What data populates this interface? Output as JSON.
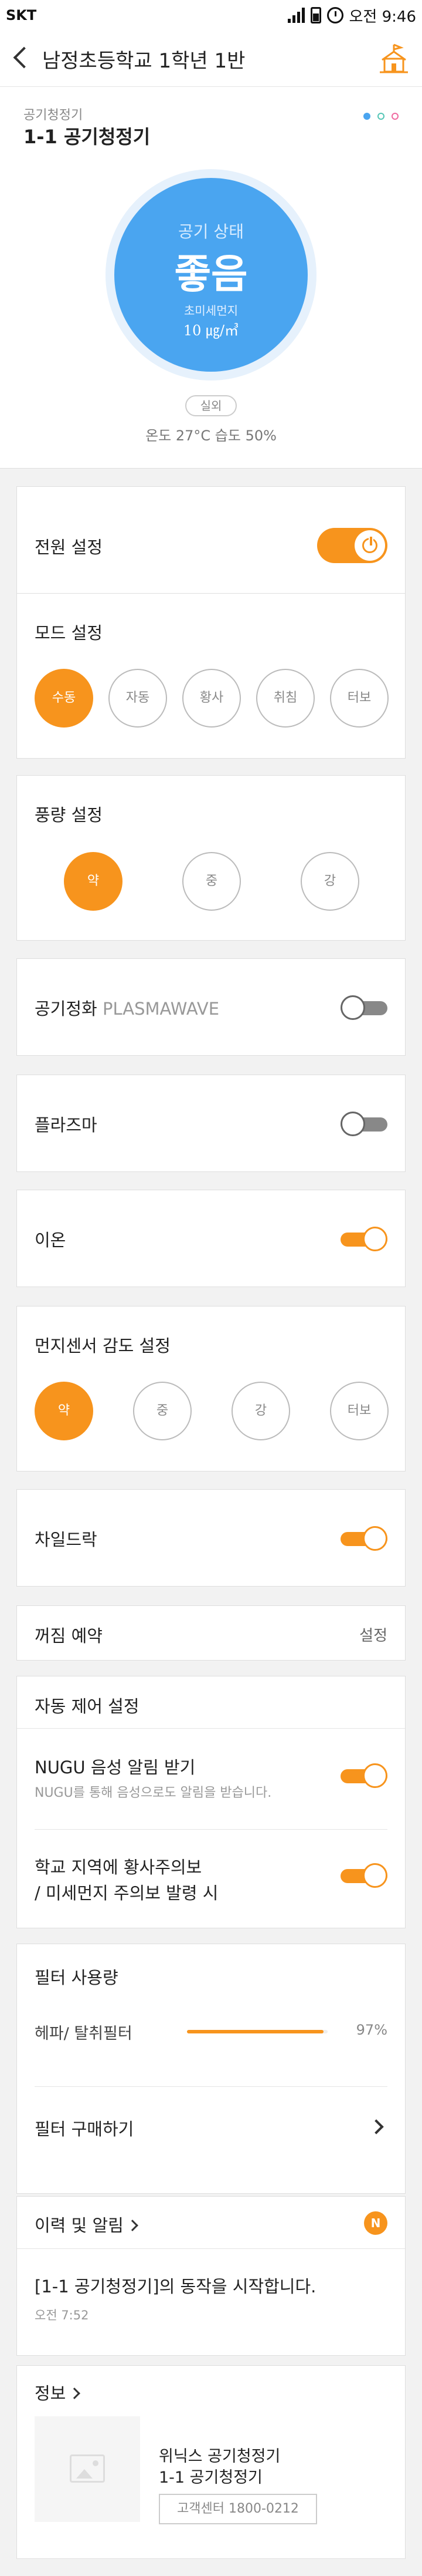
{
  "status_bar": {
    "carrier": "SKT",
    "time": "오전 9:46"
  },
  "header": {
    "title": "남정초등학교 1학년 1반"
  },
  "device": {
    "sub_label": "공기청정기",
    "name": "1-1 공기청정기",
    "air_label": "공기 상태",
    "air_state": "좋음",
    "pm_label": "초미세먼지",
    "pm_value": "10 ㎍/㎥",
    "location_chip": "실외",
    "climate": "온도 27°C   습도 50%",
    "page_dot_colors": [
      "#4aa5f0",
      "#54c6b6",
      "#f06aa0"
    ]
  },
  "power": {
    "label": "전원 설정",
    "on": true
  },
  "mode": {
    "label": "모드 설정",
    "options": [
      "수동",
      "자동",
      "황사",
      "취침",
      "터보"
    ],
    "selected": "수동"
  },
  "fan": {
    "label": "풍량 설정",
    "options": [
      "약",
      "중",
      "강"
    ],
    "selected": "약"
  },
  "plasmawave": {
    "label": "공기정화",
    "label_suffix": "PLASMAWAVE",
    "on": false
  },
  "plasma": {
    "label": "플라즈마",
    "on": false
  },
  "ion": {
    "label": "이온",
    "on": true
  },
  "dust_sensor": {
    "label": "먼지센서 감도 설정",
    "options": [
      "약",
      "중",
      "강",
      "터보"
    ],
    "selected": "약"
  },
  "child_lock": {
    "label": "차일드락",
    "on": true
  },
  "off_timer": {
    "label": "꺼짐 예약",
    "action": "설정"
  },
  "auto_control": {
    "label": "자동 제어 설정",
    "nugu": {
      "title": "NUGU 음성 알림 받기",
      "desc": "NUGU를 통해 음성으로도 알림을 받습니다.",
      "on": true
    },
    "alert": {
      "title_line1": "학교 지역에 황사주의보",
      "title_line2": "/ 미세먼지 주의보 발령 시",
      "on": true
    }
  },
  "filter": {
    "label": "필터 사용량",
    "item": "헤파/ 탈취필터",
    "percent_text": "97%",
    "percent": 97,
    "buy": "필터 구매하기"
  },
  "history": {
    "label": "이력 및 알림",
    "badge": "N",
    "message": "[1-1 공기청정기]의 동작을 시작합니다.",
    "time": "오전 7:52"
  },
  "info": {
    "label": "정보",
    "product": "위닉스 공기청정기",
    "device_name": "1-1 공기청정기",
    "cs_button": "고객센터 1800-0212"
  },
  "colors": {
    "accent": "#f7941d",
    "air_good": "#4aa5f0"
  }
}
